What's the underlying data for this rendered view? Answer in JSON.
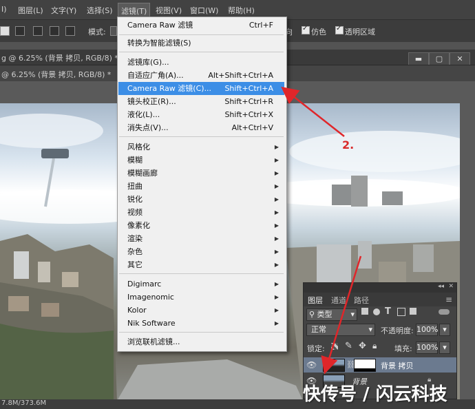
{
  "menubar": {
    "items": [
      "I)",
      "图层(L)",
      "文字(Y)",
      "选择(S)",
      "滤镜(T)",
      "视图(V)",
      "窗口(W)",
      "帮助(H)"
    ]
  },
  "options": {
    "mode_label": "模式:",
    "opt_partial": "向",
    "antialias_label": "仿色",
    "transparent_label": "透明区域"
  },
  "tabs": {
    "row1": "g @ 6.25% (背景 拷贝, RGB/8) *",
    "row2": "@ 6.25% (背景 拷贝, RGB/8) *"
  },
  "window_buttons": [
    "▬",
    "▢",
    "✕"
  ],
  "filter_menu": {
    "items": [
      {
        "label": "Camera Raw 滤镜",
        "shortcut": "Ctrl+F"
      },
      {
        "label": "转换为智能滤镜(S)",
        "shortcut": ""
      },
      {
        "label": "滤镜库(G)...",
        "shortcut": ""
      },
      {
        "label": "自适应广角(A)...",
        "shortcut": "Alt+Shift+Ctrl+A"
      },
      {
        "label": "Camera Raw 滤镜(C)...",
        "shortcut": "Shift+Ctrl+A"
      },
      {
        "label": "镜头校正(R)...",
        "shortcut": "Shift+Ctrl+R"
      },
      {
        "label": "液化(L)...",
        "shortcut": "Shift+Ctrl+X"
      },
      {
        "label": "消失点(V)...",
        "shortcut": "Alt+Ctrl+V"
      },
      {
        "label": "风格化"
      },
      {
        "label": "模糊"
      },
      {
        "label": "模糊画廊"
      },
      {
        "label": "扭曲"
      },
      {
        "label": "锐化"
      },
      {
        "label": "视频"
      },
      {
        "label": "像素化"
      },
      {
        "label": "渲染"
      },
      {
        "label": "杂色"
      },
      {
        "label": "其它"
      },
      {
        "label": "Digimarc"
      },
      {
        "label": "Imagenomic"
      },
      {
        "label": "Kolor"
      },
      {
        "label": "Nik Software"
      },
      {
        "label": "浏览联机滤镜..."
      }
    ]
  },
  "annotation": {
    "step_label": "2."
  },
  "layers_panel": {
    "tabs": [
      "图层",
      "通道",
      "路径"
    ],
    "kind_label": "类型",
    "blend_mode": "正常",
    "opacity_label": "不透明度:",
    "opacity_value": "100%",
    "lock_label": "锁定:",
    "fill_label": "填充:",
    "fill_value": "100%",
    "layers": [
      {
        "name": "背景 拷贝"
      },
      {
        "name": "背景"
      }
    ]
  },
  "status": {
    "doc_size": "7.8M/373.6M"
  },
  "watermark": "快传号 / 闪云科技"
}
